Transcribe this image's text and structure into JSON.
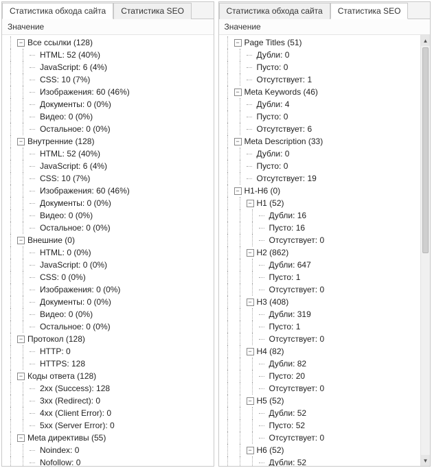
{
  "left": {
    "tabs": [
      {
        "label": "Статистика обхода сайта",
        "active": true
      },
      {
        "label": "Статистика SEO",
        "active": false
      }
    ],
    "header": "Значение",
    "tree": [
      {
        "label": "Все ссылки (128)",
        "c": [
          {
            "label": "HTML: 52 (40%)"
          },
          {
            "label": "JavaScript: 6 (4%)"
          },
          {
            "label": "CSS: 10 (7%)"
          },
          {
            "label": "Изображения: 60 (46%)"
          },
          {
            "label": "Документы: 0 (0%)"
          },
          {
            "label": "Видео: 0 (0%)"
          },
          {
            "label": "Остальное: 0 (0%)"
          }
        ]
      },
      {
        "label": "Внутренние (128)",
        "c": [
          {
            "label": "HTML: 52 (40%)"
          },
          {
            "label": "JavaScript: 6 (4%)"
          },
          {
            "label": "CSS: 10 (7%)"
          },
          {
            "label": "Изображения: 60 (46%)"
          },
          {
            "label": "Документы: 0 (0%)"
          },
          {
            "label": "Видео: 0 (0%)"
          },
          {
            "label": "Остальное: 0 (0%)"
          }
        ]
      },
      {
        "label": "Внешние (0)",
        "c": [
          {
            "label": "HTML: 0 (0%)"
          },
          {
            "label": "JavaScript: 0 (0%)"
          },
          {
            "label": "CSS: 0 (0%)"
          },
          {
            "label": "Изображения: 0 (0%)"
          },
          {
            "label": "Документы: 0 (0%)"
          },
          {
            "label": "Видео: 0 (0%)"
          },
          {
            "label": "Остальное: 0 (0%)"
          }
        ]
      },
      {
        "label": "Протокол (128)",
        "c": [
          {
            "label": "HTTP: 0"
          },
          {
            "label": "HTTPS: 128"
          }
        ]
      },
      {
        "label": "Коды ответа (128)",
        "c": [
          {
            "label": "2xx (Success): 128"
          },
          {
            "label": "3xx (Redirect): 0"
          },
          {
            "label": "4xx (Client Error): 0"
          },
          {
            "label": "5xx (Server Error): 0"
          }
        ]
      },
      {
        "label": "Meta директивы (55)",
        "c": [
          {
            "label": "Noindex: 0"
          },
          {
            "label": "Nofollow: 0"
          }
        ]
      }
    ]
  },
  "right": {
    "tabs": [
      {
        "label": "Статистика обхода сайта",
        "active": false
      },
      {
        "label": "Статистика SEO",
        "active": true
      }
    ],
    "header": "Значение",
    "tree": [
      {
        "label": "Page Titles (51)",
        "c": [
          {
            "label": "Дубли: 0"
          },
          {
            "label": "Пусто: 0"
          },
          {
            "label": "Отсутствует: 1"
          }
        ]
      },
      {
        "label": "Meta Keywords (46)",
        "c": [
          {
            "label": "Дубли: 4"
          },
          {
            "label": "Пусто: 0"
          },
          {
            "label": "Отсутствует: 6"
          }
        ]
      },
      {
        "label": "Meta Description (33)",
        "c": [
          {
            "label": "Дубли: 0"
          },
          {
            "label": "Пусто: 0"
          },
          {
            "label": "Отсутствует: 19"
          }
        ]
      },
      {
        "label": "H1-H6 (0)",
        "c": [
          {
            "label": "H1 (52)",
            "c": [
              {
                "label": "Дубли: 16"
              },
              {
                "label": "Пусто: 16"
              },
              {
                "label": "Отсутствует: 0"
              }
            ]
          },
          {
            "label": "H2 (862)",
            "c": [
              {
                "label": "Дубли: 647"
              },
              {
                "label": "Пусто: 1"
              },
              {
                "label": "Отсутствует: 0"
              }
            ]
          },
          {
            "label": "H3 (408)",
            "c": [
              {
                "label": "Дубли: 319"
              },
              {
                "label": "Пусто: 1"
              },
              {
                "label": "Отсутствует: 0"
              }
            ]
          },
          {
            "label": "H4 (82)",
            "c": [
              {
                "label": "Дубли: 82"
              },
              {
                "label": "Пусто: 20"
              },
              {
                "label": "Отсутствует: 0"
              }
            ]
          },
          {
            "label": "H5 (52)",
            "c": [
              {
                "label": "Дубли: 52"
              },
              {
                "label": "Пусто: 52"
              },
              {
                "label": "Отсутствует: 0"
              }
            ]
          },
          {
            "label": "H6 (52)",
            "c": [
              {
                "label": "Дубли: 52"
              }
            ]
          }
        ]
      }
    ]
  }
}
